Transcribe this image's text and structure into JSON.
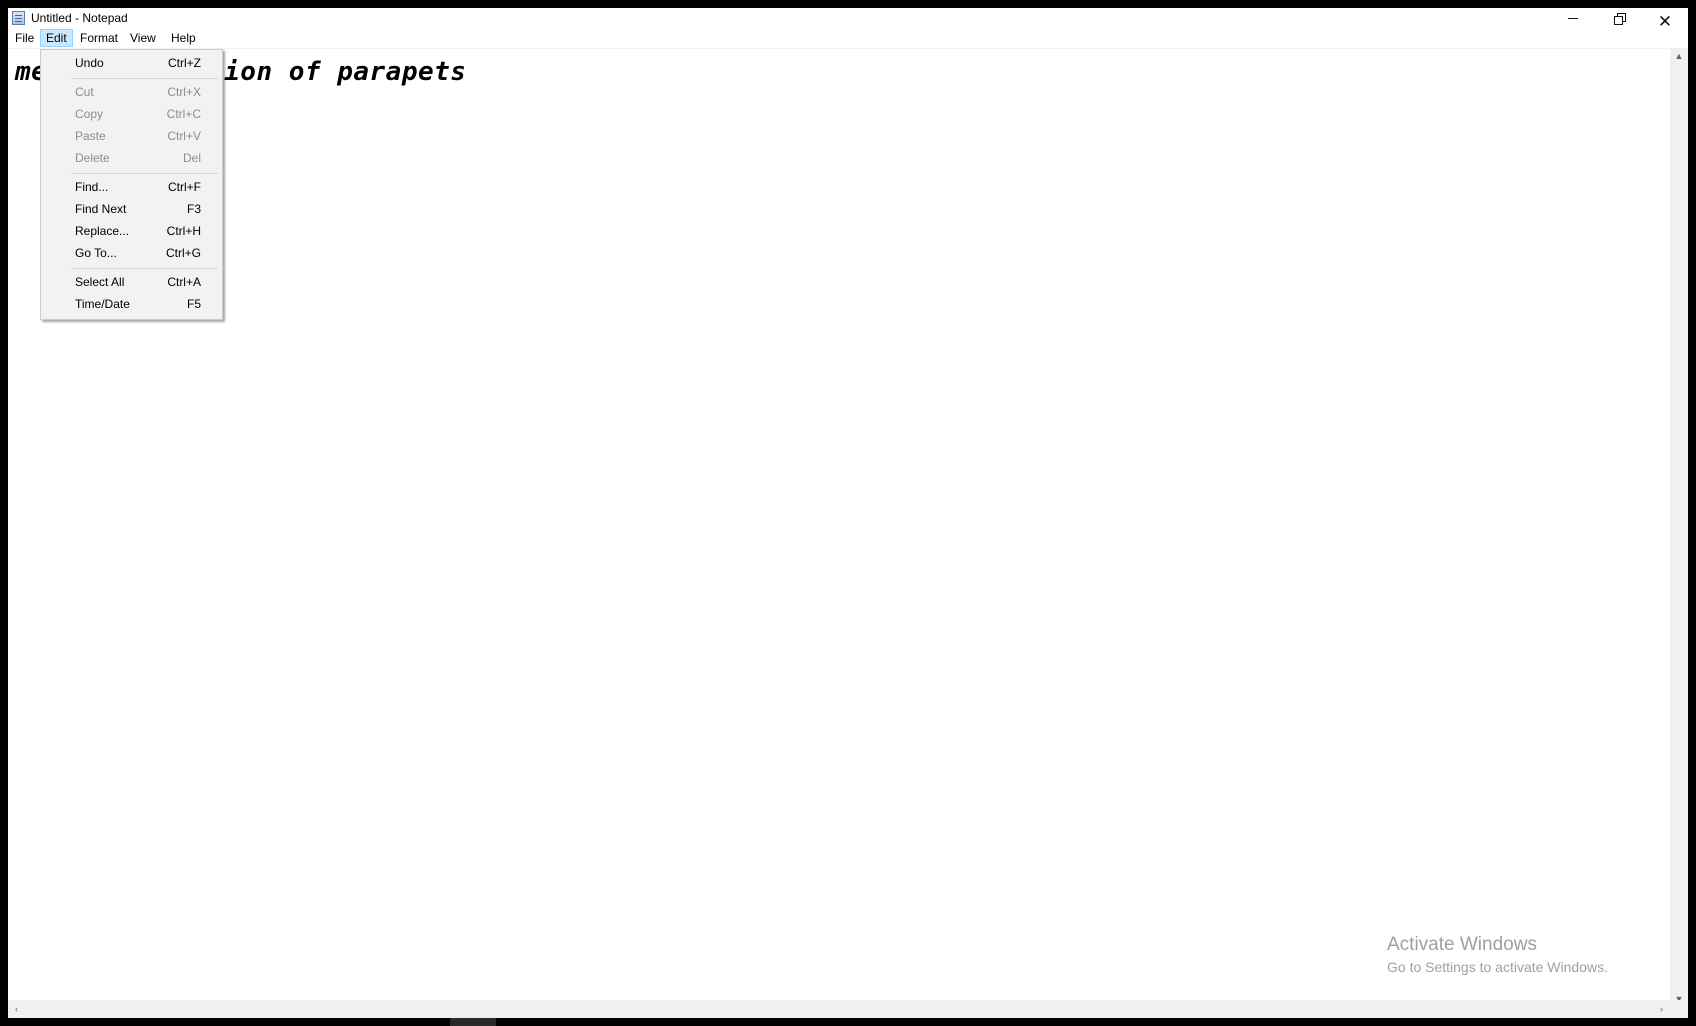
{
  "window": {
    "title": "Untitled - Notepad",
    "icon": "notepad-icon",
    "controls": {
      "minimize": "minimize-icon",
      "maximize": "restore-icon",
      "close": "✕"
    }
  },
  "menubar": {
    "items": [
      "File",
      "Edit",
      "Format",
      "View",
      "Help"
    ],
    "active": "Edit"
  },
  "editor": {
    "visible_text": "me",
    "visible_text_after_menu": "tion of parapets"
  },
  "edit_menu": {
    "items": [
      {
        "label": "Undo",
        "shortcut": "Ctrl+Z",
        "enabled": true
      },
      {
        "label": "Cut",
        "shortcut": "Ctrl+X",
        "enabled": false
      },
      {
        "label": "Copy",
        "shortcut": "Ctrl+C",
        "enabled": false
      },
      {
        "label": "Paste",
        "shortcut": "Ctrl+V",
        "enabled": false
      },
      {
        "label": "Delete",
        "shortcut": "Del",
        "enabled": false
      },
      {
        "label": "Find...",
        "shortcut": "Ctrl+F",
        "enabled": true
      },
      {
        "label": "Find Next",
        "shortcut": "F3",
        "enabled": true
      },
      {
        "label": "Replace...",
        "shortcut": "Ctrl+H",
        "enabled": true
      },
      {
        "label": "Go To...",
        "shortcut": "Ctrl+G",
        "enabled": true
      },
      {
        "label": "Select All",
        "shortcut": "Ctrl+A",
        "enabled": true
      },
      {
        "label": "Time/Date",
        "shortcut": "F5",
        "enabled": true
      }
    ]
  },
  "watermark": {
    "title": "Activate Windows",
    "subtitle": "Go to Settings to activate Windows."
  },
  "scrollbars": {
    "up_arrow": "▲",
    "down_arrow": "▼",
    "left_arrow": "‹",
    "right_arrow": "›"
  },
  "colors": {
    "menu_highlight": "#cce8ff",
    "menu_background": "#f2f2f2",
    "disabled_text": "#8d8d8d",
    "watermark_text": "#a0a0a0"
  }
}
